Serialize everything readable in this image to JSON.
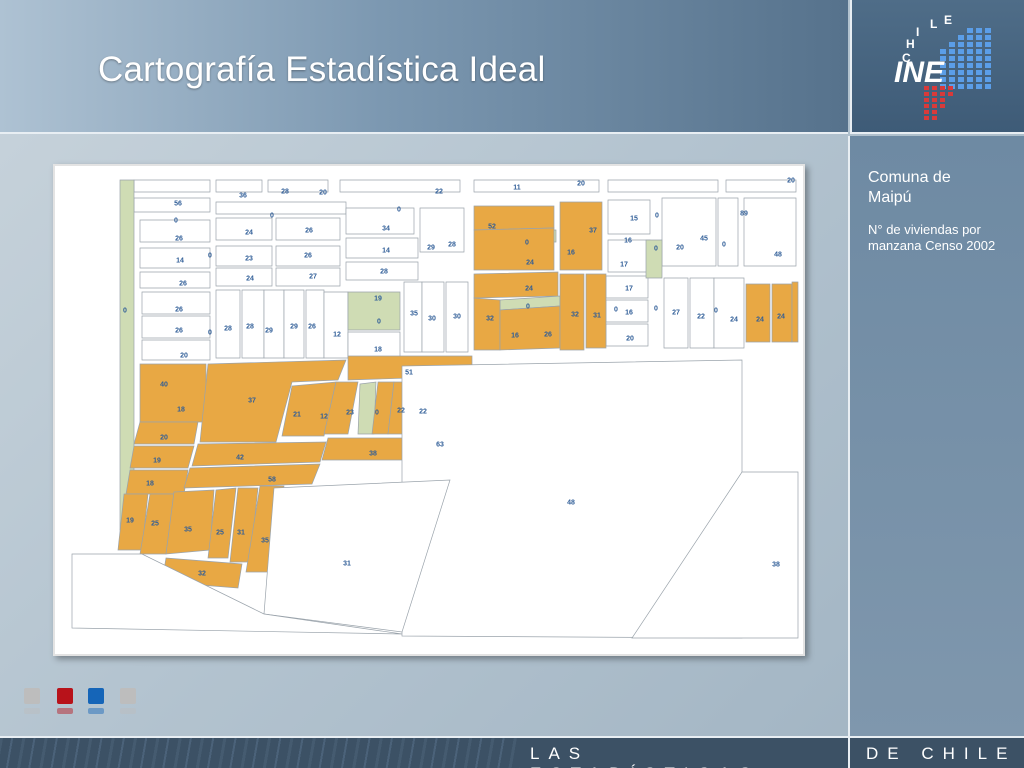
{
  "header": {
    "title": "Cartografía Estadística Ideal"
  },
  "logo": {
    "arc_text": "CHILE",
    "wordmark": "INE"
  },
  "sidebar": {
    "title": "Comuna de Maipú",
    "subtitle": "N° de viviendas por manzana Censo 2002"
  },
  "footer": {
    "left_text": "LAS ESTADÍSTICAS",
    "right_text": "DE CHILE"
  },
  "colors": {
    "highlight_block": "#e8a844",
    "park": "#cfdcb4",
    "label": "#2f5d97",
    "square_1": "#bdbdbd",
    "square_2": "#b8121a",
    "square_3": "#1565b8",
    "square_4": "#bdbdbd"
  },
  "map": {
    "labels": [
      {
        "text": "36"
      },
      {
        "text": "28"
      },
      {
        "text": "20"
      },
      {
        "text": "22"
      },
      {
        "text": "11"
      },
      {
        "text": "20"
      },
      {
        "text": "20"
      },
      {
        "text": "56"
      },
      {
        "text": "0"
      },
      {
        "text": "0"
      },
      {
        "text": "0"
      },
      {
        "text": "34"
      },
      {
        "text": "52"
      },
      {
        "text": "37"
      },
      {
        "text": "15"
      },
      {
        "text": "0"
      },
      {
        "text": "89"
      },
      {
        "text": "26"
      },
      {
        "text": "24"
      },
      {
        "text": "26"
      },
      {
        "text": "14"
      },
      {
        "text": "29"
      },
      {
        "text": "28"
      },
      {
        "text": "0"
      },
      {
        "text": "16"
      },
      {
        "text": "16"
      },
      {
        "text": "0"
      },
      {
        "text": "20"
      },
      {
        "text": "45"
      },
      {
        "text": "0"
      },
      {
        "text": "48"
      },
      {
        "text": "14"
      },
      {
        "text": "0"
      },
      {
        "text": "23"
      },
      {
        "text": "26"
      },
      {
        "text": "28"
      },
      {
        "text": "24"
      },
      {
        "text": "17"
      },
      {
        "text": "26"
      },
      {
        "text": "24"
      },
      {
        "text": "27"
      },
      {
        "text": "24"
      },
      {
        "text": "17"
      },
      {
        "text": "0"
      },
      {
        "text": "26"
      },
      {
        "text": "19"
      },
      {
        "text": "0"
      },
      {
        "text": "16"
      },
      {
        "text": "0"
      },
      {
        "text": "27"
      },
      {
        "text": "22"
      },
      {
        "text": "0"
      },
      {
        "text": "24"
      },
      {
        "text": "24"
      },
      {
        "text": "24"
      },
      {
        "text": "26"
      },
      {
        "text": "0"
      },
      {
        "text": "28"
      },
      {
        "text": "28"
      },
      {
        "text": "29"
      },
      {
        "text": "29"
      },
      {
        "text": "26"
      },
      {
        "text": "12"
      },
      {
        "text": "0"
      },
      {
        "text": "35"
      },
      {
        "text": "30"
      },
      {
        "text": "30"
      },
      {
        "text": "32"
      },
      {
        "text": "0"
      },
      {
        "text": "32"
      },
      {
        "text": "31"
      },
      {
        "text": "16"
      },
      {
        "text": "26"
      },
      {
        "text": "20"
      },
      {
        "text": "20"
      },
      {
        "text": "18"
      },
      {
        "text": "51"
      },
      {
        "text": "40"
      },
      {
        "text": "37"
      },
      {
        "text": "18"
      },
      {
        "text": "21"
      },
      {
        "text": "12"
      },
      {
        "text": "23"
      },
      {
        "text": "0"
      },
      {
        "text": "22"
      },
      {
        "text": "22"
      },
      {
        "text": "20"
      },
      {
        "text": "63"
      },
      {
        "text": "38"
      },
      {
        "text": "42"
      },
      {
        "text": "19"
      },
      {
        "text": "58"
      },
      {
        "text": "18"
      },
      {
        "text": "48"
      },
      {
        "text": "19"
      },
      {
        "text": "25"
      },
      {
        "text": "35"
      },
      {
        "text": "25"
      },
      {
        "text": "31"
      },
      {
        "text": "35"
      },
      {
        "text": "31"
      },
      {
        "text": "38"
      },
      {
        "text": "32"
      }
    ]
  }
}
